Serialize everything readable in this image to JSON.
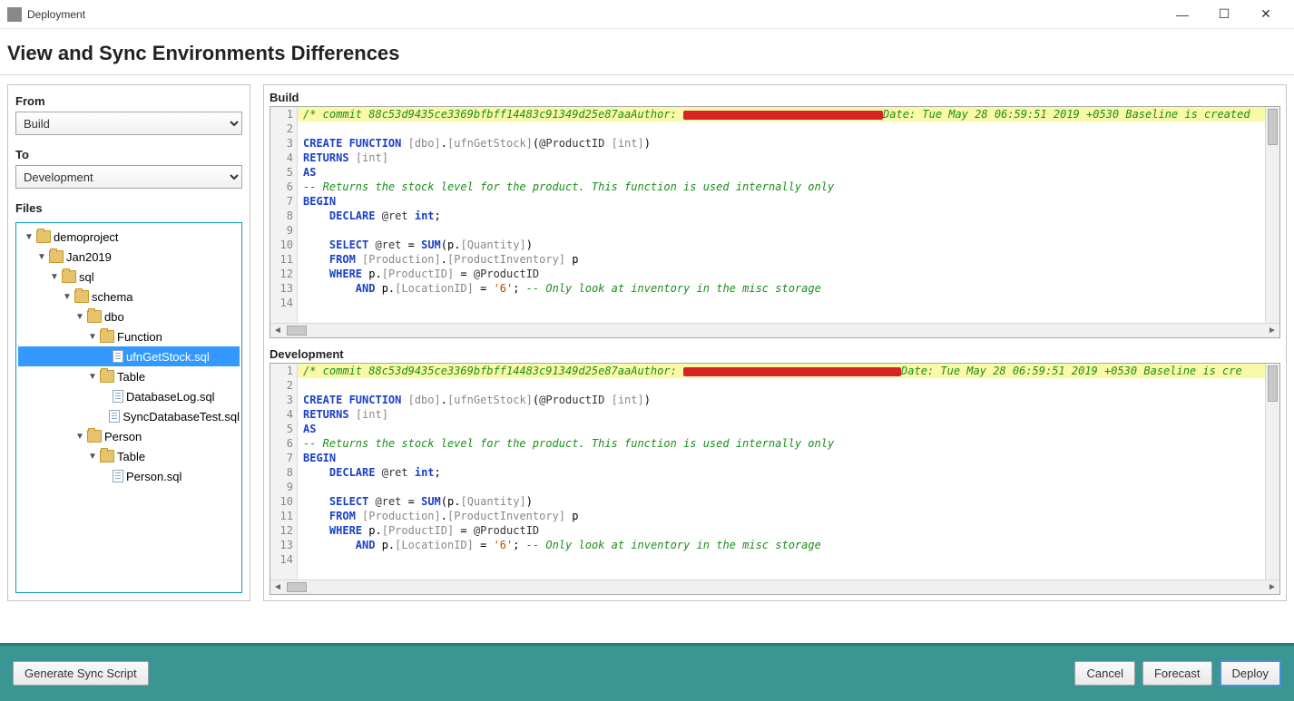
{
  "window": {
    "title": "Deployment"
  },
  "header": {
    "title": "View and Sync Environments Differences"
  },
  "panel": {
    "from_label": "From",
    "from_value": "Build",
    "to_label": "To",
    "to_value": "Development",
    "files_label": "Files"
  },
  "tree": {
    "n0": "demoproject",
    "n1": "Jan2019",
    "n2": "sql",
    "n3": "schema",
    "n4": "dbo",
    "n5": "Function",
    "n6": "ufnGetStock.sql",
    "n7": "Table",
    "n8": "DatabaseLog.sql",
    "n9": "SyncDatabaseTest.sql",
    "n10": "Person",
    "n11": "Table",
    "n12": "Person.sql"
  },
  "panes": {
    "build_title": "Build",
    "dev_title": "Development"
  },
  "code_build": {
    "commit_prefix": "/* commit 88c53d9435ce3369bfbff14483c91349d25e87aaAuthor: ",
    "commit_date": "Date:   Tue May 28 06:59:51 2019 +0530    Baseline is created",
    "l3": "CREATE FUNCTION [dbo].[ufnGetStock](@ProductID [int])",
    "l4": "RETURNS [int]",
    "l5": "AS",
    "l6": "-- Returns the stock level for the product. This function is used internally only",
    "l7": "BEGIN",
    "l8": "    DECLARE @ret int;",
    "l10": "    SELECT @ret = SUM(p.[Quantity])",
    "l11": "    FROM [Production].[ProductInventory] p",
    "l12": "    WHERE p.[ProductID] = @ProductID",
    "l13a": "        AND p.[LocationID] = '6'; ",
    "l13b": "-- Only look at inventory in the misc storage"
  },
  "code_dev": {
    "commit_prefix": "/* commit 88c53d9435ce3369bfbff14483c91349d25e87aaAuthor: ",
    "commit_date": "Date:   Tue May 28 06:59:51 2019 +0530    Baseline is cre",
    "l3": "CREATE FUNCTION [dbo].[ufnGetStock](@ProductID [int])",
    "l4": "RETURNS [int]",
    "l5": "AS",
    "l6": "-- Returns the stock level for the product. This function is used internally only",
    "l7": "BEGIN",
    "l8": "    DECLARE @ret int;",
    "l10": "    SELECT @ret = SUM(p.[Quantity])",
    "l11": "    FROM [Production].[ProductInventory] p",
    "l12": "    WHERE p.[ProductID] = @ProductID",
    "l13a": "        AND p.[LocationID] = '6'; ",
    "l13b": "-- Only look at inventory in the misc storage"
  },
  "footer": {
    "generate": "Generate Sync Script",
    "cancel": "Cancel",
    "forecast": "Forecast",
    "deploy": "Deploy"
  }
}
